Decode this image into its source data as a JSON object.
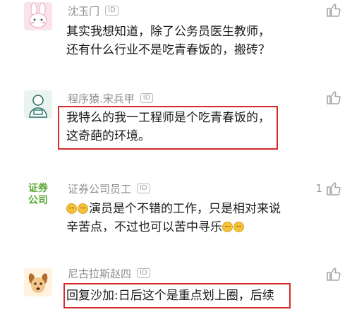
{
  "comments": [
    {
      "username": "沈玉门",
      "id_badge": "ID",
      "avatar": "bunny-avatar",
      "likes": "",
      "lines": [
        "其实我想知道，除了公务员医生教师，",
        "还有什么行业不是吃青春饭的，搬砖？"
      ],
      "highlighted": false
    },
    {
      "username": "程序猿.宋兵甲",
      "id_badge": "ID",
      "avatar": "programmer-avatar",
      "likes": "",
      "lines": [
        "我特么的我一工程师是个吃青春饭的，",
        "这奇葩的环境。"
      ],
      "highlighted": true
    },
    {
      "username": "证券公司员工",
      "id_badge": "ID",
      "avatar": "securities-company-avatar",
      "avatar_text_line1": "证券",
      "avatar_text_line2": "公司",
      "likes": "1",
      "lines_before_emoji": "",
      "line1_text": "演员是个不错的工作，只是相对来说",
      "line2_text": "辛苦点，不过也可以苦中寻乐",
      "highlighted": false
    },
    {
      "username": "尼古拉斯赵四",
      "id_badge": "ID",
      "avatar": "dog-avatar",
      "likes": "",
      "lines": [
        "回复沙加:日后这个是重点划上圈，后续"
      ],
      "highlighted": true
    }
  ],
  "colors": {
    "highlight_border": "#d62a2a",
    "username": "#8c8c8c",
    "text": "#1a1a1a",
    "securities_green": "#5aa832"
  },
  "icons": {
    "like": "thumbs-up-icon",
    "emoji": "grinning-face-icon"
  }
}
